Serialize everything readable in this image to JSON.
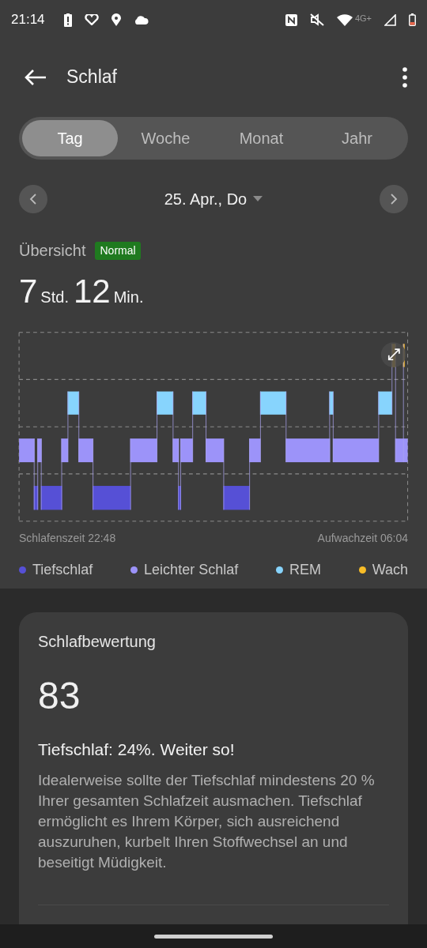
{
  "status_bar": {
    "time": "21:14",
    "network": "4G+"
  },
  "header": {
    "title": "Schlaf"
  },
  "tabs": [
    {
      "label": "Tag",
      "selected": true
    },
    {
      "label": "Woche",
      "selected": false
    },
    {
      "label": "Monat",
      "selected": false
    },
    {
      "label": "Jahr",
      "selected": false
    }
  ],
  "date": {
    "label": "25. Apr., Do"
  },
  "overview": {
    "title": "Übersicht",
    "badge": "Normal",
    "hours": "7",
    "hours_unit": "Std.",
    "minutes": "12",
    "minutes_unit": "Min."
  },
  "chart": {
    "bedtime": "Schlafenszeit 22:48",
    "wake_time": "Aufwachzeit 06:04"
  },
  "legend": [
    {
      "label": "Tiefschlaf",
      "color": "#5650d6"
    },
    {
      "label": "Leichter Schlaf",
      "color": "#9c93f9"
    },
    {
      "label": "REM",
      "color": "#87d4fd"
    },
    {
      "label": "Wach",
      "color": "#f7bc27"
    }
  ],
  "score_card": {
    "title": "Schlafbewertung",
    "score": "83",
    "headline": "Tiefschlaf: 24%. Weiter so!",
    "body": "Idealerweise sollte der Tiefschlaf mindestens 20 % Ihrer gesamten Schlafzeit ausmachen. Tiefschlaf ermöglicht es Ihrem Körper, sich ausreichend auszuruhen, kurbelt Ihren Stoffwechsel an und beseitigt Müdigkeit."
  }
}
